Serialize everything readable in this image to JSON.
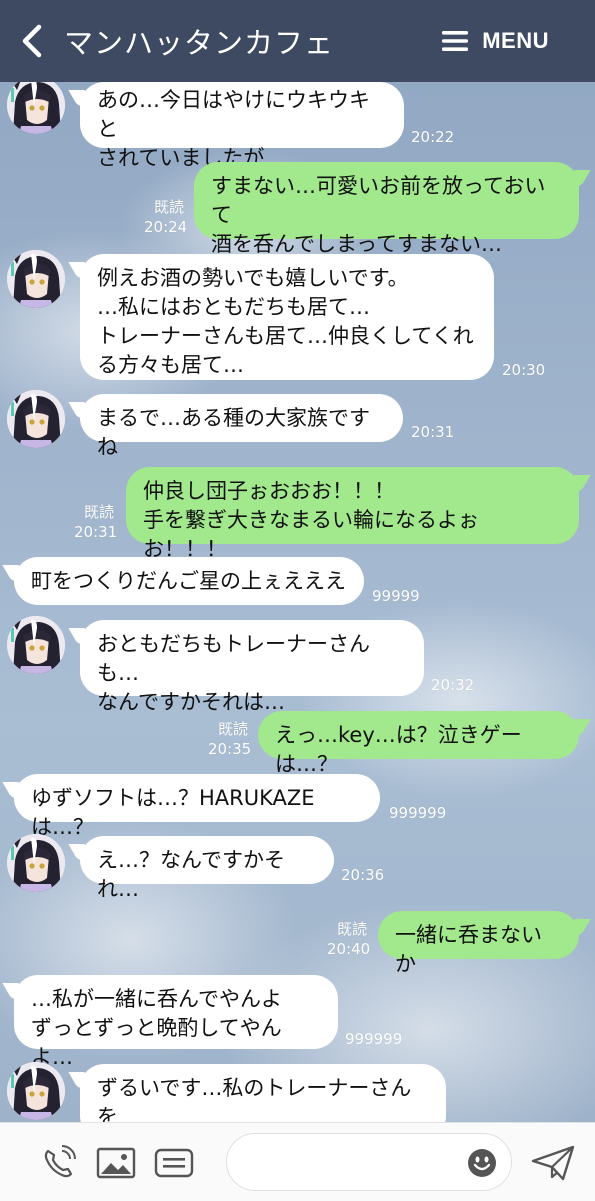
{
  "header": {
    "title": "マンハッタンカフェ",
    "menu_label": "MENU",
    "background": "#3d4a61"
  },
  "icons": {
    "back": "chevron-left-icon",
    "menu": "hamburger-icon",
    "call": "phone-call-icon",
    "image": "image-icon",
    "list": "card-icon",
    "emoji": "smiley-icon",
    "send": "paper-plane-icon"
  },
  "colors": {
    "outgoing_bubble": "#a2e88c",
    "incoming_bubble": "#ffffff"
  },
  "messages": [
    {
      "side": "left",
      "avatar": true,
      "text": "あの…今日はやけにウキウキと\nされていましたが…",
      "time": "20:22"
    },
    {
      "side": "right",
      "read": "既読",
      "text": "すまない…可愛いお前を放っておいて\n酒を呑んでしまってすまない…",
      "time": "20:24"
    },
    {
      "side": "left",
      "avatar": true,
      "text": "例えお酒の勢いでも嬉しいです。\n…私にはおともだちも居て…\nトレーナーさんも居て…仲良くしてくれ\nる方々も居て…",
      "time": "20:30"
    },
    {
      "side": "left",
      "avatar": true,
      "text": "まるで…ある種の大家族ですね",
      "time": "20:31"
    },
    {
      "side": "right",
      "read": "既読",
      "text": "仲良し団子ぉおおお！！！\n手を繋ぎ大きなまるい輪になるよぉお！！！",
      "time": "20:31"
    },
    {
      "side": "left",
      "avatar": false,
      "text": "町をつくりだんご星の上ぇえええ",
      "time": "99999"
    },
    {
      "side": "left",
      "avatar": true,
      "text": "おともだちもトレーナーさんも…\nなんですかそれは…",
      "time": "20:32"
    },
    {
      "side": "right",
      "read": "既読",
      "text": "えっ…key…は？泣きゲーは…？",
      "time": "20:35"
    },
    {
      "side": "left",
      "avatar": false,
      "text": "ゆずソフトは…？HARUKAZEは…？",
      "time": "999999"
    },
    {
      "side": "left",
      "avatar": true,
      "text": "え…？なんですかそれ…",
      "time": "20:36"
    },
    {
      "side": "right",
      "read": "既読",
      "text": "一緒に呑まないか",
      "time": "20:40"
    },
    {
      "side": "left",
      "avatar": false,
      "text": "…私が一緒に呑んでやんよ\nずっとずっと晩酌してやんよ…",
      "time": "999999"
    },
    {
      "side": "left",
      "avatar": true,
      "text": "ずるいです…私のトレーナーさんを\n独り占めしないでください",
      "time": ""
    }
  ]
}
